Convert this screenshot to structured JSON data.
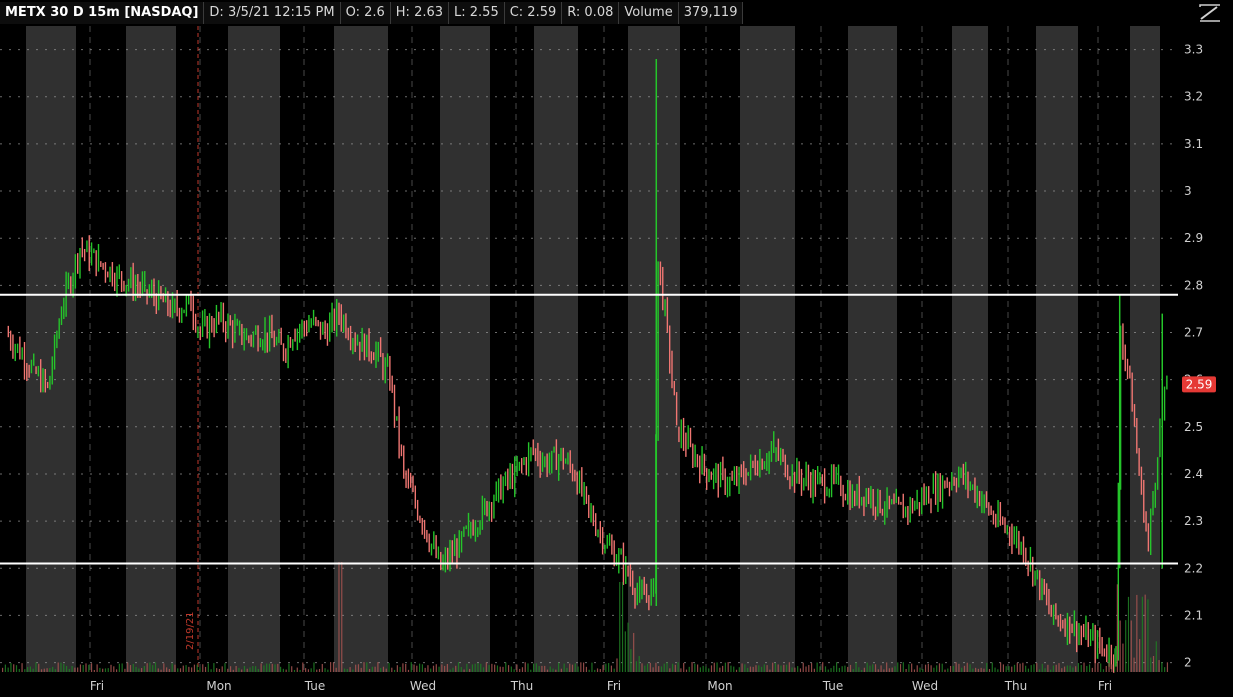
{
  "header": {
    "symbol": "METX 30 D 15m [NASDAQ]",
    "date": "D: 3/5/21 12:15 PM",
    "open": "O: 2.6",
    "high": "H: 2.63",
    "low": "L: 2.55",
    "close": "C: 2.59",
    "range": "R: 0.08",
    "volume_label": "Volume",
    "volume_value": "379,119"
  },
  "icons": {
    "corner": "expand-chart-icon"
  },
  "chart_data": {
    "type": "candlestick",
    "title": "METX 30 D 15m [NASDAQ]",
    "ylim": [
      1.98,
      3.35
    ],
    "y_ticks": [
      2,
      2.1,
      2.2,
      2.3,
      2.4,
      2.5,
      2.6,
      2.7,
      2.8,
      2.9,
      3,
      3.1,
      3.2,
      3.3
    ],
    "x_labels": [
      "Fri",
      "Mon",
      "Tue",
      "Wed",
      "Thu",
      "Fri",
      "Mon",
      "Tue",
      "Wed",
      "Thu",
      "Fri"
    ],
    "price_path": [
      [
        0,
        2.7
      ],
      [
        0.3,
        2.62
      ],
      [
        0.45,
        2.58
      ],
      [
        0.6,
        2.75
      ],
      [
        0.8,
        2.88
      ],
      [
        1.0,
        2.85
      ],
      [
        1.2,
        2.82
      ],
      [
        1.5,
        2.79
      ],
      [
        1.8,
        2.75
      ],
      [
        2.0,
        2.76
      ],
      [
        2.1,
        2.7
      ],
      [
        2.3,
        2.73
      ],
      [
        2.5,
        2.7
      ],
      [
        2.6,
        2.69
      ],
      [
        2.8,
        2.7
      ],
      [
        2.9,
        2.68
      ],
      [
        3.0,
        2.66
      ],
      [
        3.1,
        2.7
      ],
      [
        3.3,
        2.72
      ],
      [
        3.45,
        2.7
      ],
      [
        3.6,
        2.74
      ],
      [
        3.8,
        2.68
      ],
      [
        4.0,
        2.66
      ],
      [
        4.15,
        2.6
      ],
      [
        4.3,
        2.4
      ],
      [
        4.5,
        2.3
      ],
      [
        4.7,
        2.2
      ],
      [
        4.9,
        2.25
      ],
      [
        5.0,
        2.28
      ],
      [
        5.15,
        2.32
      ],
      [
        5.3,
        2.36
      ],
      [
        5.5,
        2.4
      ],
      [
        5.7,
        2.45
      ],
      [
        5.85,
        2.42
      ],
      [
        6.0,
        2.44
      ],
      [
        6.15,
        2.4
      ],
      [
        6.3,
        2.32
      ],
      [
        6.5,
        2.25
      ],
      [
        6.7,
        2.2
      ],
      [
        6.85,
        2.14
      ],
      [
        7.0,
        2.15
      ],
      [
        7.05,
        2.85
      ],
      [
        7.15,
        2.7
      ],
      [
        7.25,
        2.5
      ],
      [
        7.4,
        2.45
      ],
      [
        7.6,
        2.4
      ],
      [
        7.85,
        2.38
      ],
      [
        8.0,
        2.4
      ],
      [
        8.1,
        2.42
      ],
      [
        8.3,
        2.45
      ],
      [
        8.5,
        2.4
      ],
      [
        8.75,
        2.38
      ],
      [
        9.0,
        2.38
      ],
      [
        9.15,
        2.35
      ],
      [
        9.3,
        2.36
      ],
      [
        9.5,
        2.33
      ],
      [
        9.7,
        2.32
      ],
      [
        9.85,
        2.34
      ],
      [
        10.0,
        2.36
      ],
      [
        10.15,
        2.38
      ],
      [
        10.3,
        2.4
      ],
      [
        10.5,
        2.36
      ],
      [
        10.7,
        2.3
      ],
      [
        10.85,
        2.28
      ],
      [
        11.0,
        2.24
      ],
      [
        11.15,
        2.18
      ],
      [
        11.3,
        2.1
      ],
      [
        11.5,
        2.08
      ],
      [
        11.7,
        2.05
      ],
      [
        11.85,
        2.03
      ],
      [
        12.0,
        2.02
      ],
      [
        12.05,
        2.7
      ],
      [
        12.15,
        2.6
      ],
      [
        12.25,
        2.4
      ],
      [
        12.35,
        2.25
      ],
      [
        12.45,
        2.45
      ],
      [
        12.55,
        2.59
      ]
    ],
    "spikes": [
      {
        "x": 7.03,
        "low": 2.12,
        "high": 3.28
      },
      {
        "x": 12.04,
        "low": 2.2,
        "high": 2.78
      },
      {
        "x": 12.5,
        "low": 2.2,
        "high": 2.74
      }
    ],
    "horizontal_lines": [
      2.78,
      2.21
    ],
    "last_price": 2.59,
    "last_price_label": "2.59",
    "ext_hours_marker": "2/19/21",
    "colors": {
      "up": "#25c52a",
      "down": "#f07672",
      "bg": "#000000",
      "shade": "#303030",
      "last": "#e53935"
    }
  }
}
